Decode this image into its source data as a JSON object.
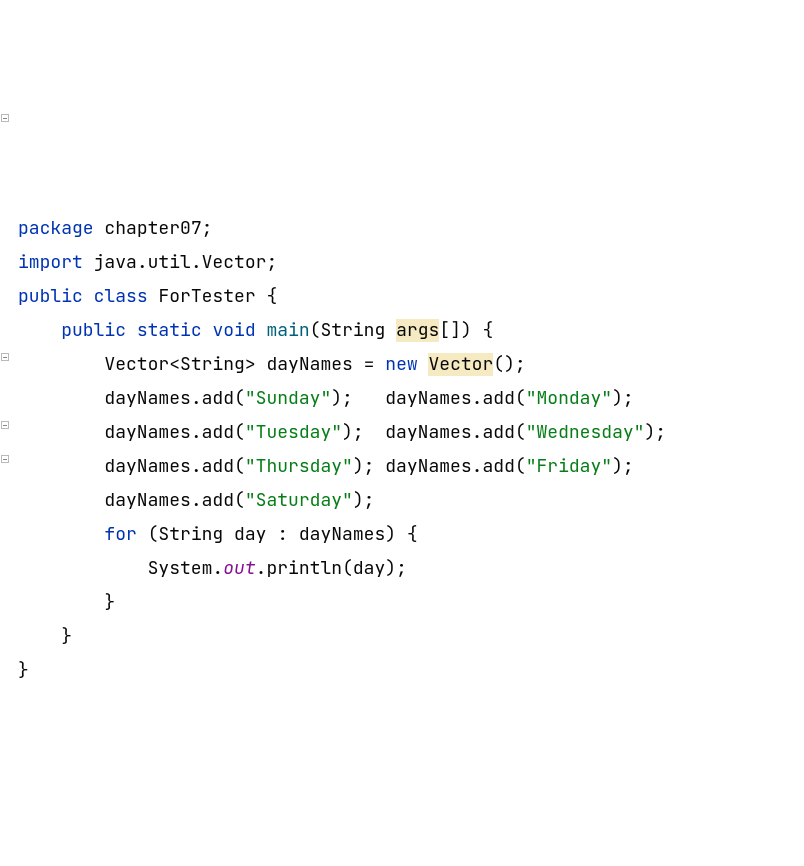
{
  "code": {
    "kw_package": "package",
    "pkg_name": "chapter07",
    "kw_import": "import",
    "import_path": "java.util.Vector",
    "kw_public": "public",
    "kw_class": "class",
    "class_name": "ForTester",
    "kw_static": "static",
    "kw_void": "void",
    "method_main": "main",
    "param_type": "String",
    "param_name": "args",
    "vector_type": "Vector",
    "generic_type": "String",
    "var_dayNames": "dayNames",
    "kw_new": "new",
    "method_add": "add",
    "str_sun": "\"Sunday\"",
    "str_mon": "\"Monday\"",
    "str_tue": "\"Tuesday\"",
    "str_wed": "\"Wednesday\"",
    "str_thu": "\"Thursday\"",
    "str_fri": "\"Friday\"",
    "str_sat": "\"Saturday\"",
    "kw_for": "for",
    "loop_type": "String",
    "loop_var": "day",
    "sys": "System",
    "out": "out",
    "println": "println"
  }
}
